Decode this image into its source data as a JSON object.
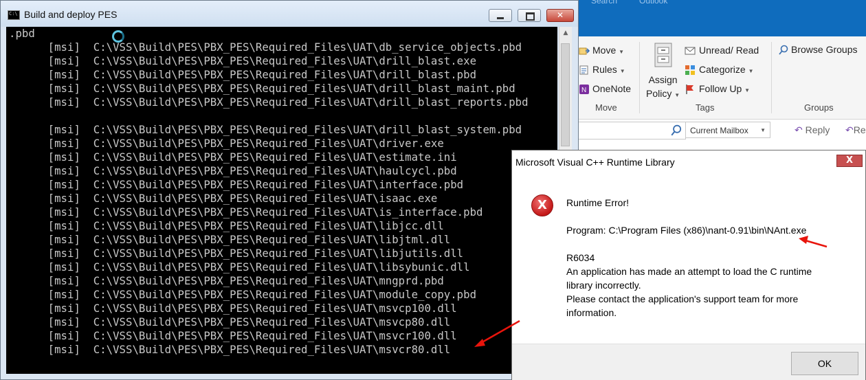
{
  "outlook": {
    "topbar_sliver": [
      "Search",
      "Outlook"
    ],
    "ribbon": {
      "move_label": "Move",
      "rules_label": "Rules",
      "onenote_label": "OneNote",
      "move_group": "Move",
      "assign_policy_line1": "Assign",
      "assign_policy_line2": "Policy",
      "unread_read_label": "Unread/ Read",
      "categorize_label": "Categorize",
      "follow_up_label": "Follow Up",
      "tags_group": "Tags",
      "browse_groups_label": "Browse Groups",
      "groups_group": "Groups"
    },
    "search": {
      "mailbox_scope": "Current Mailbox"
    },
    "reading": {
      "reply_label": "Reply",
      "reply_all_partial": "Re"
    }
  },
  "console": {
    "title": "Build and deploy PES",
    "lines": [
      ".pbd",
      "      [msi]  C:\\VSS\\Build\\PES\\PBX_PES\\Required_Files\\UAT\\db_service_objects.pbd",
      "      [msi]  C:\\VSS\\Build\\PES\\PBX_PES\\Required_Files\\UAT\\drill_blast.exe",
      "      [msi]  C:\\VSS\\Build\\PES\\PBX_PES\\Required_Files\\UAT\\drill_blast.pbd",
      "      [msi]  C:\\VSS\\Build\\PES\\PBX_PES\\Required_Files\\UAT\\drill_blast_maint.pbd",
      "      [msi]  C:\\VSS\\Build\\PES\\PBX_PES\\Required_Files\\UAT\\drill_blast_reports.pbd",
      "",
      "      [msi]  C:\\VSS\\Build\\PES\\PBX_PES\\Required_Files\\UAT\\drill_blast_system.pbd",
      "      [msi]  C:\\VSS\\Build\\PES\\PBX_PES\\Required_Files\\UAT\\driver.exe",
      "      [msi]  C:\\VSS\\Build\\PES\\PBX_PES\\Required_Files\\UAT\\estimate.ini",
      "      [msi]  C:\\VSS\\Build\\PES\\PBX_PES\\Required_Files\\UAT\\haulcycl.pbd",
      "      [msi]  C:\\VSS\\Build\\PES\\PBX_PES\\Required_Files\\UAT\\interface.pbd",
      "      [msi]  C:\\VSS\\Build\\PES\\PBX_PES\\Required_Files\\UAT\\isaac.exe",
      "      [msi]  C:\\VSS\\Build\\PES\\PBX_PES\\Required_Files\\UAT\\is_interface.pbd",
      "      [msi]  C:\\VSS\\Build\\PES\\PBX_PES\\Required_Files\\UAT\\libjcc.dll",
      "      [msi]  C:\\VSS\\Build\\PES\\PBX_PES\\Required_Files\\UAT\\libjtml.dll",
      "      [msi]  C:\\VSS\\Build\\PES\\PBX_PES\\Required_Files\\UAT\\libjutils.dll",
      "      [msi]  C:\\VSS\\Build\\PES\\PBX_PES\\Required_Files\\UAT\\libsybunic.dll",
      "      [msi]  C:\\VSS\\Build\\PES\\PBX_PES\\Required_Files\\UAT\\mngprd.pbd",
      "      [msi]  C:\\VSS\\Build\\PES\\PBX_PES\\Required_Files\\UAT\\module_copy.pbd",
      "      [msi]  C:\\VSS\\Build\\PES\\PBX_PES\\Required_Files\\UAT\\msvcp100.dll",
      "      [msi]  C:\\VSS\\Build\\PES\\PBX_PES\\Required_Files\\UAT\\msvcp80.dll",
      "      [msi]  C:\\VSS\\Build\\PES\\PBX_PES\\Required_Files\\UAT\\msvcr100.dll",
      "      [msi]  C:\\VSS\\Build\\PES\\PBX_PES\\Required_Files\\UAT\\msvcr80.dll"
    ]
  },
  "dialog": {
    "title": "Microsoft Visual C++ Runtime Library",
    "close_symbol": "X",
    "icon_symbol": "X",
    "error_heading": "Runtime Error!",
    "program_line": "Program: C:\\Program Files (x86)\\nant-0.91\\bin\\NAnt.exe",
    "error_code": "R6034",
    "message_line1": "An application has made an attempt to load the C runtime",
    "message_line2": "library incorrectly.",
    "message_line3": "Please contact the application's support team for more",
    "message_line4": "information.",
    "ok_label": "OK"
  },
  "colors": {
    "annotation_arrow": "#e8140c",
    "console_bg": "#000000",
    "console_text": "#c8c8c8",
    "outlook_blue": "#0f6cbd"
  }
}
